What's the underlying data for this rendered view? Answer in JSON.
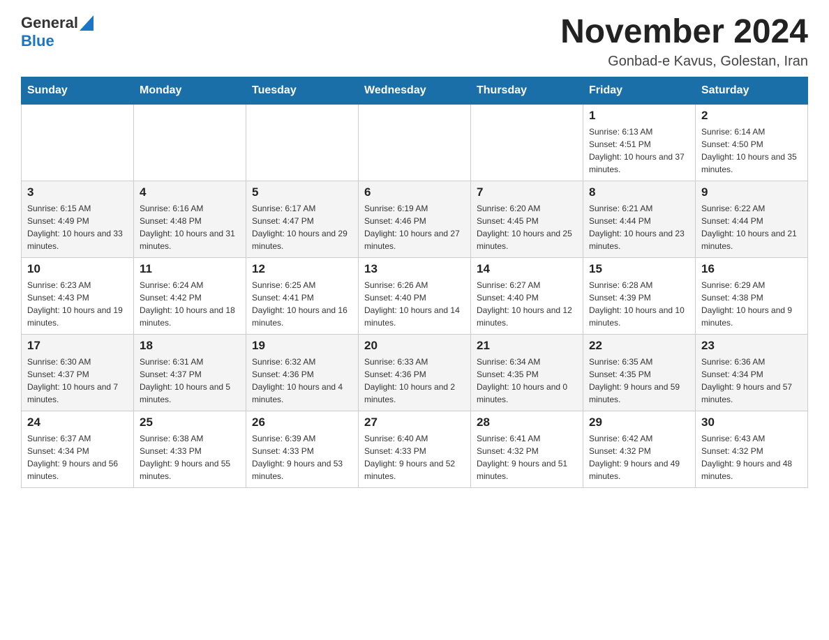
{
  "header": {
    "logo_general": "General",
    "logo_blue": "Blue",
    "month_title": "November 2024",
    "subtitle": "Gonbad-e Kavus, Golestan, Iran"
  },
  "weekdays": [
    "Sunday",
    "Monday",
    "Tuesday",
    "Wednesday",
    "Thursday",
    "Friday",
    "Saturday"
  ],
  "weeks": [
    [
      {
        "day": "",
        "sunrise": "",
        "sunset": "",
        "daylight": ""
      },
      {
        "day": "",
        "sunrise": "",
        "sunset": "",
        "daylight": ""
      },
      {
        "day": "",
        "sunrise": "",
        "sunset": "",
        "daylight": ""
      },
      {
        "day": "",
        "sunrise": "",
        "sunset": "",
        "daylight": ""
      },
      {
        "day": "",
        "sunrise": "",
        "sunset": "",
        "daylight": ""
      },
      {
        "day": "1",
        "sunrise": "Sunrise: 6:13 AM",
        "sunset": "Sunset: 4:51 PM",
        "daylight": "Daylight: 10 hours and 37 minutes."
      },
      {
        "day": "2",
        "sunrise": "Sunrise: 6:14 AM",
        "sunset": "Sunset: 4:50 PM",
        "daylight": "Daylight: 10 hours and 35 minutes."
      }
    ],
    [
      {
        "day": "3",
        "sunrise": "Sunrise: 6:15 AM",
        "sunset": "Sunset: 4:49 PM",
        "daylight": "Daylight: 10 hours and 33 minutes."
      },
      {
        "day": "4",
        "sunrise": "Sunrise: 6:16 AM",
        "sunset": "Sunset: 4:48 PM",
        "daylight": "Daylight: 10 hours and 31 minutes."
      },
      {
        "day": "5",
        "sunrise": "Sunrise: 6:17 AM",
        "sunset": "Sunset: 4:47 PM",
        "daylight": "Daylight: 10 hours and 29 minutes."
      },
      {
        "day": "6",
        "sunrise": "Sunrise: 6:19 AM",
        "sunset": "Sunset: 4:46 PM",
        "daylight": "Daylight: 10 hours and 27 minutes."
      },
      {
        "day": "7",
        "sunrise": "Sunrise: 6:20 AM",
        "sunset": "Sunset: 4:45 PM",
        "daylight": "Daylight: 10 hours and 25 minutes."
      },
      {
        "day": "8",
        "sunrise": "Sunrise: 6:21 AM",
        "sunset": "Sunset: 4:44 PM",
        "daylight": "Daylight: 10 hours and 23 minutes."
      },
      {
        "day": "9",
        "sunrise": "Sunrise: 6:22 AM",
        "sunset": "Sunset: 4:44 PM",
        "daylight": "Daylight: 10 hours and 21 minutes."
      }
    ],
    [
      {
        "day": "10",
        "sunrise": "Sunrise: 6:23 AM",
        "sunset": "Sunset: 4:43 PM",
        "daylight": "Daylight: 10 hours and 19 minutes."
      },
      {
        "day": "11",
        "sunrise": "Sunrise: 6:24 AM",
        "sunset": "Sunset: 4:42 PM",
        "daylight": "Daylight: 10 hours and 18 minutes."
      },
      {
        "day": "12",
        "sunrise": "Sunrise: 6:25 AM",
        "sunset": "Sunset: 4:41 PM",
        "daylight": "Daylight: 10 hours and 16 minutes."
      },
      {
        "day": "13",
        "sunrise": "Sunrise: 6:26 AM",
        "sunset": "Sunset: 4:40 PM",
        "daylight": "Daylight: 10 hours and 14 minutes."
      },
      {
        "day": "14",
        "sunrise": "Sunrise: 6:27 AM",
        "sunset": "Sunset: 4:40 PM",
        "daylight": "Daylight: 10 hours and 12 minutes."
      },
      {
        "day": "15",
        "sunrise": "Sunrise: 6:28 AM",
        "sunset": "Sunset: 4:39 PM",
        "daylight": "Daylight: 10 hours and 10 minutes."
      },
      {
        "day": "16",
        "sunrise": "Sunrise: 6:29 AM",
        "sunset": "Sunset: 4:38 PM",
        "daylight": "Daylight: 10 hours and 9 minutes."
      }
    ],
    [
      {
        "day": "17",
        "sunrise": "Sunrise: 6:30 AM",
        "sunset": "Sunset: 4:37 PM",
        "daylight": "Daylight: 10 hours and 7 minutes."
      },
      {
        "day": "18",
        "sunrise": "Sunrise: 6:31 AM",
        "sunset": "Sunset: 4:37 PM",
        "daylight": "Daylight: 10 hours and 5 minutes."
      },
      {
        "day": "19",
        "sunrise": "Sunrise: 6:32 AM",
        "sunset": "Sunset: 4:36 PM",
        "daylight": "Daylight: 10 hours and 4 minutes."
      },
      {
        "day": "20",
        "sunrise": "Sunrise: 6:33 AM",
        "sunset": "Sunset: 4:36 PM",
        "daylight": "Daylight: 10 hours and 2 minutes."
      },
      {
        "day": "21",
        "sunrise": "Sunrise: 6:34 AM",
        "sunset": "Sunset: 4:35 PM",
        "daylight": "Daylight: 10 hours and 0 minutes."
      },
      {
        "day": "22",
        "sunrise": "Sunrise: 6:35 AM",
        "sunset": "Sunset: 4:35 PM",
        "daylight": "Daylight: 9 hours and 59 minutes."
      },
      {
        "day": "23",
        "sunrise": "Sunrise: 6:36 AM",
        "sunset": "Sunset: 4:34 PM",
        "daylight": "Daylight: 9 hours and 57 minutes."
      }
    ],
    [
      {
        "day": "24",
        "sunrise": "Sunrise: 6:37 AM",
        "sunset": "Sunset: 4:34 PM",
        "daylight": "Daylight: 9 hours and 56 minutes."
      },
      {
        "day": "25",
        "sunrise": "Sunrise: 6:38 AM",
        "sunset": "Sunset: 4:33 PM",
        "daylight": "Daylight: 9 hours and 55 minutes."
      },
      {
        "day": "26",
        "sunrise": "Sunrise: 6:39 AM",
        "sunset": "Sunset: 4:33 PM",
        "daylight": "Daylight: 9 hours and 53 minutes."
      },
      {
        "day": "27",
        "sunrise": "Sunrise: 6:40 AM",
        "sunset": "Sunset: 4:33 PM",
        "daylight": "Daylight: 9 hours and 52 minutes."
      },
      {
        "day": "28",
        "sunrise": "Sunrise: 6:41 AM",
        "sunset": "Sunset: 4:32 PM",
        "daylight": "Daylight: 9 hours and 51 minutes."
      },
      {
        "day": "29",
        "sunrise": "Sunrise: 6:42 AM",
        "sunset": "Sunset: 4:32 PM",
        "daylight": "Daylight: 9 hours and 49 minutes."
      },
      {
        "day": "30",
        "sunrise": "Sunrise: 6:43 AM",
        "sunset": "Sunset: 4:32 PM",
        "daylight": "Daylight: 9 hours and 48 minutes."
      }
    ]
  ]
}
